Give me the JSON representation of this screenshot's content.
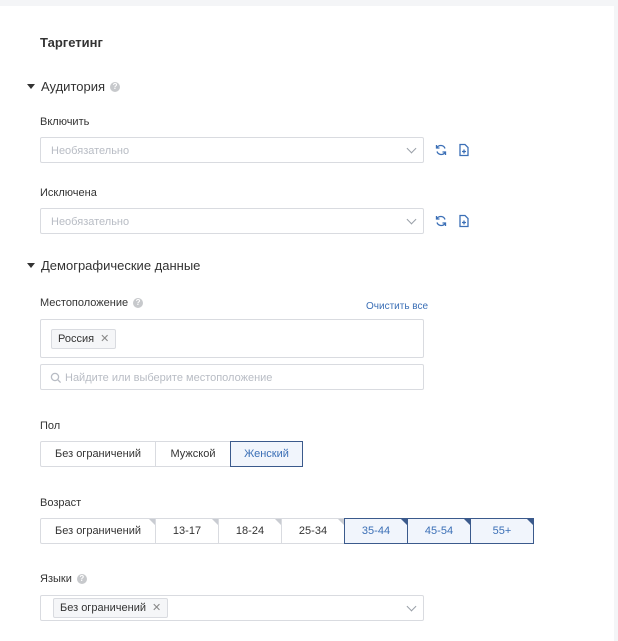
{
  "page": {
    "title": "Таргетинг"
  },
  "audience": {
    "heading": "Аудитория",
    "include_label": "Включить",
    "include_placeholder": "Необязательно",
    "exclude_label": "Исключена",
    "exclude_placeholder": "Необязательно"
  },
  "demographics": {
    "heading": "Демографические данные",
    "location_label": "Местоположение",
    "clear_all": "Очистить все",
    "location_tags": [
      "Россия"
    ],
    "location_search_placeholder": "Найдите или выберите местоположение",
    "gender_label": "Пол",
    "gender_options": [
      "Без ограничений",
      "Мужской",
      "Женский"
    ],
    "gender_selected": "Женский",
    "age_label": "Возраст",
    "age_options": [
      "Без ограничений",
      "13-17",
      "18-24",
      "25-34",
      "35-44",
      "45-54",
      "55+"
    ],
    "age_selected": [
      "35-44",
      "45-54",
      "55+"
    ],
    "languages_label": "Языки",
    "language_tags": [
      "Без ограничений"
    ]
  },
  "icons": {
    "refresh": "refresh-icon",
    "add_file": "file-add-icon",
    "help": "help-circle-icon",
    "search": "search-icon",
    "chevron": "chevron-down-icon",
    "close": "close-icon"
  },
  "colors": {
    "accent": "#3b6fb6",
    "selected_border": "#3b5a8c",
    "border": "#d9dbe0",
    "placeholder": "#b8bcc4"
  }
}
